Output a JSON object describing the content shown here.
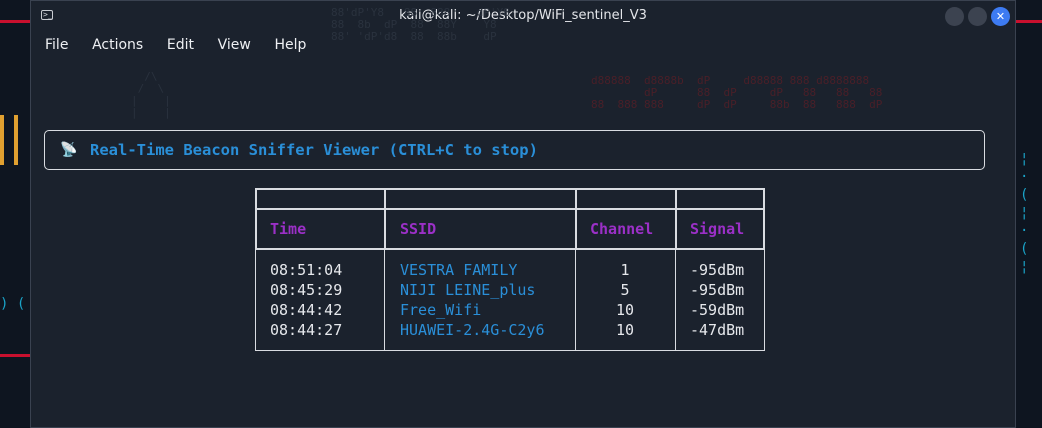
{
  "window": {
    "title": "kali@kali: ~/Desktop/WiFi_sentinel_V3",
    "close_glyph": "✕"
  },
  "menu": {
    "items": [
      "File",
      "Actions",
      "Edit",
      "View",
      "Help"
    ]
  },
  "banner": {
    "icon": "satellite-antenna-icon",
    "icon_glyph": "📡",
    "title": "Real-Time Beacon Sniffer Viewer (CTRL+C to stop)"
  },
  "table": {
    "headers": [
      "Time",
      "SSID",
      "Channel",
      "Signal"
    ],
    "rows": [
      {
        "time": "08:51:04",
        "ssid": "VESTRA FAMILY",
        "channel": "1",
        "signal": "-95dBm"
      },
      {
        "time": "08:45:29",
        "ssid": "NIJI LEINE_plus",
        "channel": "5",
        "signal": "-95dBm"
      },
      {
        "time": "08:44:42",
        "ssid": "Free_Wifi",
        "channel": "10",
        "signal": "-59dBm"
      },
      {
        "time": "08:44:27",
        "ssid": "HUAWEI-2.4G-C2y6",
        "channel": "10",
        "signal": "-47dBm"
      }
    ]
  },
  "colors": {
    "accent_blue": "#2a8fd8",
    "header_purple": "#9b30c7",
    "window_bg": "#1b222d"
  }
}
